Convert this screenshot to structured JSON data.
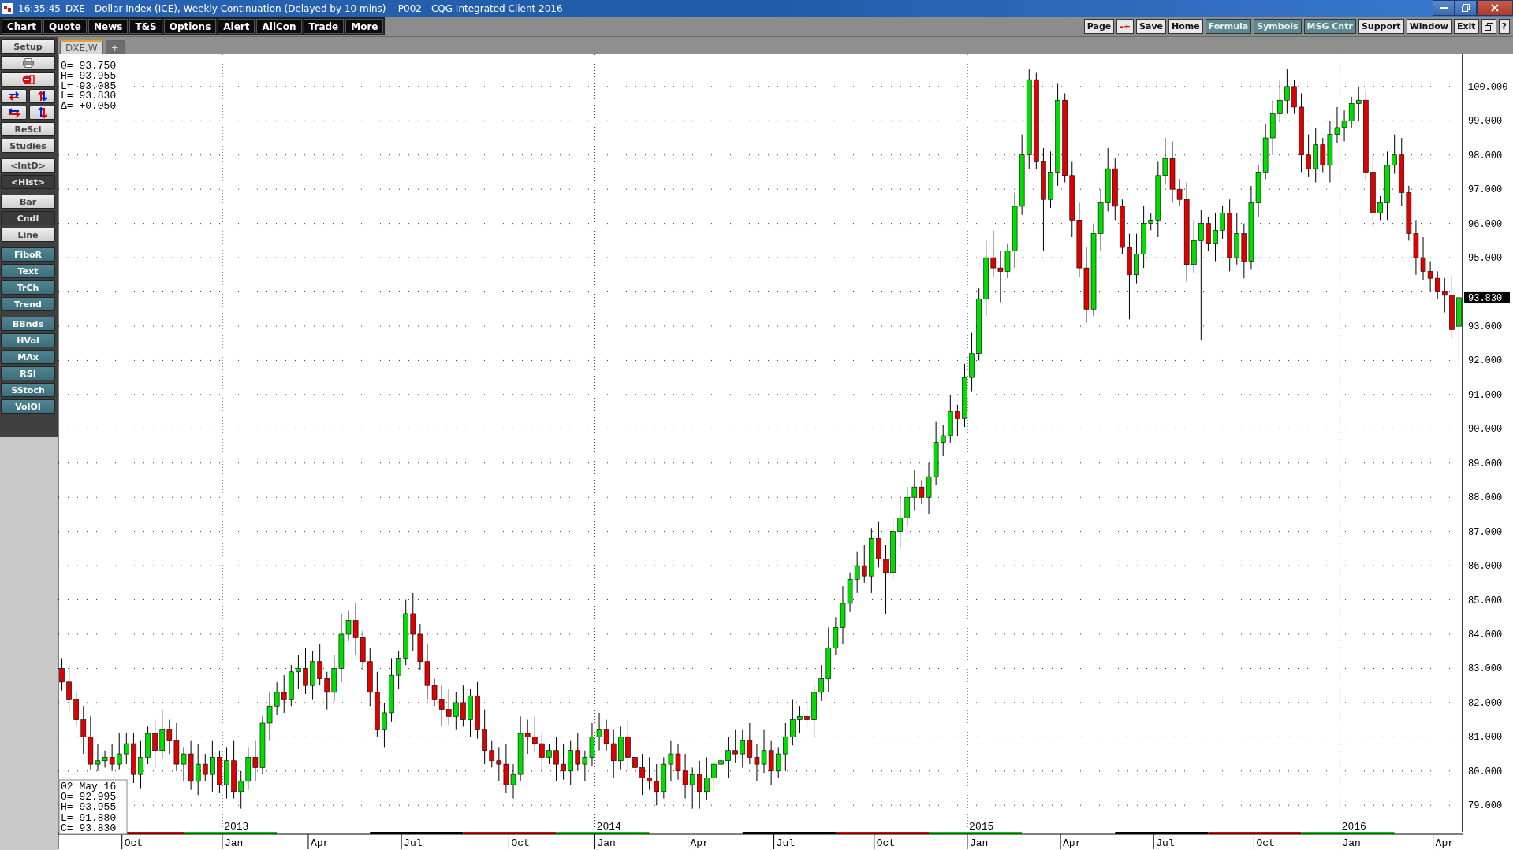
{
  "window": {
    "time": "16:35:45",
    "title": "DXE - Dollar Index (ICE), Weekly Continuation (Delayed by 10 mins)    P002 - CQG Integrated Client 2016"
  },
  "toolbar": {
    "left": [
      {
        "label": "Chart"
      },
      {
        "label": "Quote"
      },
      {
        "label": "News"
      },
      {
        "label": "T&S"
      },
      {
        "label": "Options"
      },
      {
        "label": "Alert"
      },
      {
        "label": "AllCon"
      },
      {
        "label": "Trade"
      },
      {
        "label": "More"
      }
    ],
    "right": [
      {
        "label": "Page",
        "kind": "light"
      },
      {
        "label": "-+",
        "kind": "light"
      },
      {
        "label": "Save",
        "kind": "light"
      },
      {
        "label": "Home",
        "kind": "light"
      },
      {
        "label": "Formula",
        "kind": "teal"
      },
      {
        "label": "Symbols",
        "kind": "teal"
      },
      {
        "label": "MSG Cntr",
        "kind": "teal"
      },
      {
        "label": "Support",
        "kind": "light"
      },
      {
        "label": "Window",
        "kind": "light"
      },
      {
        "label": "Exit",
        "kind": "light"
      },
      {
        "kind": "icon"
      },
      {
        "label": "?",
        "kind": "light"
      }
    ]
  },
  "sidebar": {
    "groups": [
      [
        {
          "kind": "light",
          "label": "Setup",
          "selected": false
        },
        {
          "kind": "wide_icon"
        },
        {
          "kind": "wide_icon"
        },
        {
          "kind": "half_icon"
        },
        {
          "kind": "half_icon"
        },
        {
          "kind": "half_icon"
        },
        {
          "kind": "half_icon"
        },
        {
          "kind": "light",
          "label": "ReScl",
          "selected": false
        },
        {
          "kind": "light",
          "label": "Studies",
          "selected": false
        }
      ],
      [
        {
          "kind": "light",
          "label": "<IntD>",
          "selected": false
        },
        {
          "kind": "light",
          "label": "<Hist>",
          "selected": true
        }
      ],
      [
        {
          "kind": "light",
          "label": "Bar",
          "selected": false
        },
        {
          "kind": "light",
          "label": "Cndl",
          "selected": true
        },
        {
          "kind": "light",
          "label": "Line",
          "selected": false
        }
      ],
      [
        {
          "kind": "teal",
          "label": "FiboR",
          "selected": false
        },
        {
          "kind": "teal",
          "label": "Text",
          "selected": false
        },
        {
          "kind": "teal",
          "label": "TrCh",
          "selected": false
        },
        {
          "kind": "teal",
          "label": "Trend",
          "selected": false
        }
      ],
      [
        {
          "kind": "teal",
          "label": "BBnds",
          "selected": false
        },
        {
          "kind": "teal",
          "label": "HVol",
          "selected": false
        },
        {
          "kind": "teal",
          "label": "MAx",
          "selected": false
        },
        {
          "kind": "teal",
          "label": "RSI",
          "selected": false
        },
        {
          "kind": "teal",
          "label": "SStoch",
          "selected": false
        },
        {
          "kind": "teal",
          "label": "VolOI",
          "selected": false
        }
      ]
    ]
  },
  "tabs": [
    {
      "label": "DXE,W",
      "selected": true
    },
    {
      "label": "+",
      "selected": false
    }
  ],
  "chart": {
    "readout": [
      "0= 93.750",
      "H= 93.955",
      "L= 93.085",
      "L= 93.830",
      "Δ= +0.050"
    ],
    "bar_info": [
      "02 May 16",
      "O=  92.995",
      "H=  93.955",
      "L=  91.880",
      "C=  93.830"
    ],
    "last_price": "93.830",
    "year_labels": [
      "2013",
      "2014",
      "2015",
      "2016"
    ],
    "chart_data": {
      "type": "candlestick",
      "grid": true,
      "ylim": [
        78.2,
        100.9
      ],
      "categories": [
        null,
        null,
        null,
        null,
        null,
        null,
        null,
        null,
        null,
        null,
        "Oct",
        null,
        null,
        null,
        null,
        null,
        null,
        null,
        null,
        null,
        null,
        null,
        null,
        null,
        "Jan",
        null,
        null,
        null,
        null,
        null,
        null,
        null,
        null,
        null,
        null,
        null,
        "Apr",
        null,
        null,
        null,
        null,
        null,
        null,
        null,
        null,
        null,
        null,
        null,
        null,
        "Jul",
        null,
        null,
        null,
        null,
        null,
        null,
        null,
        null,
        null,
        null,
        null,
        null,
        null,
        null,
        "Oct",
        null,
        null,
        null,
        null,
        null,
        null,
        null,
        null,
        null,
        null,
        null,
        "Jan",
        null,
        null,
        null,
        null,
        null,
        null,
        null,
        null,
        null,
        null,
        null,
        null,
        "Apr",
        null,
        null,
        null,
        null,
        null,
        null,
        null,
        null,
        null,
        null,
        null,
        "Jul",
        null,
        null,
        null,
        null,
        null,
        null,
        null,
        null,
        null,
        null,
        null,
        null,
        null,
        "Oct",
        null,
        null,
        null,
        null,
        null,
        null,
        null,
        null,
        null,
        null,
        null,
        null,
        "Jan",
        null,
        null,
        null,
        null,
        null,
        null,
        null,
        null,
        null,
        null,
        null,
        null,
        "Apr",
        null,
        null,
        null,
        null,
        null,
        null,
        null,
        null,
        null,
        null,
        null,
        null,
        "Jul",
        null,
        null,
        null,
        null,
        null,
        null,
        null,
        null,
        null,
        null,
        null,
        null,
        null,
        "Oct",
        null,
        null,
        null,
        null,
        null,
        null,
        null,
        null,
        null,
        null,
        null,
        "Jan",
        null,
        null,
        null,
        null,
        null,
        null,
        null,
        null,
        null,
        null,
        null,
        null,
        "Apr",
        null,
        null
      ],
      "yticks": [
        {
          "value": 79,
          "label": "79.000"
        },
        {
          "value": 80,
          "label": "80.000"
        },
        {
          "value": 81,
          "label": "81.000"
        },
        {
          "value": 82,
          "label": "82.000"
        },
        {
          "value": 83,
          "label": "83.000"
        },
        {
          "value": 84,
          "label": "84.000"
        },
        {
          "value": 85,
          "label": "85.000"
        },
        {
          "value": 86,
          "label": "86.000"
        },
        {
          "value": 87,
          "label": "87.000"
        },
        {
          "value": 88,
          "label": "88.000"
        },
        {
          "value": 89,
          "label": "89.000"
        },
        {
          "value": 90,
          "label": "90.000"
        },
        {
          "value": 91,
          "label": "91.000"
        },
        {
          "value": 92,
          "label": "92.000"
        },
        {
          "value": 93,
          "label": "93.000"
        },
        {
          "value": 95,
          "label": "95.000"
        },
        {
          "value": 96,
          "label": "96.000"
        },
        {
          "value": 97,
          "label": "97.000"
        },
        {
          "value": 98,
          "label": "98.000"
        },
        {
          "value": 99,
          "label": "99.000"
        },
        {
          "value": 100,
          "label": "100.000"
        }
      ],
      "ohlc": [
        [
          83.0,
          83.3,
          82.35,
          82.6
        ],
        [
          82.6,
          83.1,
          81.7,
          82.1
        ],
        [
          82.1,
          82.3,
          81.3,
          81.5
        ],
        [
          81.5,
          81.9,
          80.5,
          81.0
        ],
        [
          81.0,
          81.6,
          80.05,
          80.2
        ],
        [
          80.2,
          80.8,
          80.0,
          80.3
        ],
        [
          80.3,
          80.6,
          80.1,
          80.4
        ],
        [
          80.4,
          80.8,
          80.0,
          80.2
        ],
        [
          80.2,
          81.1,
          80.05,
          80.5
        ],
        [
          80.5,
          81.1,
          80.2,
          80.8
        ],
        [
          80.8,
          81.1,
          79.65,
          79.9
        ],
        [
          79.9,
          80.9,
          79.5,
          80.4
        ],
        [
          80.4,
          81.3,
          80.2,
          81.1
        ],
        [
          81.1,
          81.5,
          80.1,
          80.6
        ],
        [
          80.6,
          81.8,
          80.35,
          81.2
        ],
        [
          81.2,
          81.5,
          80.5,
          80.9
        ],
        [
          80.9,
          81.4,
          80.0,
          80.2
        ],
        [
          80.2,
          80.7,
          79.7,
          80.5
        ],
        [
          80.5,
          80.9,
          79.45,
          79.7
        ],
        [
          79.7,
          80.8,
          79.3,
          80.2
        ],
        [
          80.2,
          80.5,
          79.7,
          79.9
        ],
        [
          79.9,
          80.9,
          79.4,
          80.4
        ],
        [
          80.4,
          80.6,
          79.35,
          79.6
        ],
        [
          79.6,
          80.7,
          79.2,
          80.3
        ],
        [
          80.3,
          80.9,
          79.2,
          79.4
        ],
        [
          79.4,
          80.0,
          78.9,
          79.7
        ],
        [
          79.7,
          80.7,
          79.45,
          80.4
        ],
        [
          80.4,
          80.9,
          79.7,
          80.1
        ],
        [
          80.1,
          81.6,
          79.9,
          81.4
        ],
        [
          81.4,
          82.3,
          80.9,
          81.9
        ],
        [
          81.9,
          82.6,
          81.65,
          82.3
        ],
        [
          82.3,
          82.8,
          81.7,
          82.1
        ],
        [
          82.1,
          83.1,
          81.9,
          82.9
        ],
        [
          82.9,
          83.4,
          82.4,
          83.0
        ],
        [
          83.0,
          83.6,
          82.25,
          82.5
        ],
        [
          82.5,
          83.5,
          82.1,
          83.2
        ],
        [
          83.2,
          83.7,
          82.5,
          82.7
        ],
        [
          82.7,
          82.9,
          81.8,
          82.3
        ],
        [
          82.3,
          83.4,
          82.05,
          83.0
        ],
        [
          83.0,
          84.6,
          82.6,
          84.0
        ],
        [
          84.0,
          84.7,
          83.8,
          84.4
        ],
        [
          84.4,
          84.9,
          83.4,
          83.9
        ],
        [
          83.9,
          84.1,
          82.95,
          83.2
        ],
        [
          83.2,
          83.6,
          81.9,
          82.3
        ],
        [
          82.3,
          82.9,
          81.0,
          81.2
        ],
        [
          81.2,
          82.0,
          80.7,
          81.7
        ],
        [
          81.7,
          83.3,
          81.45,
          82.8
        ],
        [
          82.8,
          83.5,
          82.4,
          83.3
        ],
        [
          83.3,
          85.0,
          83.1,
          84.6
        ],
        [
          84.6,
          85.2,
          83.5,
          84.0
        ],
        [
          84.0,
          84.3,
          82.95,
          83.2
        ],
        [
          83.2,
          83.7,
          82.1,
          82.5
        ],
        [
          82.5,
          82.7,
          81.9,
          82.1
        ],
        [
          82.1,
          82.5,
          81.3,
          81.8
        ],
        [
          81.8,
          82.4,
          81.35,
          81.6
        ],
        [
          81.6,
          82.3,
          81.2,
          82.0
        ],
        [
          82.0,
          82.5,
          81.3,
          81.5
        ],
        [
          81.5,
          82.4,
          81.0,
          82.2
        ],
        [
          82.2,
          82.6,
          80.95,
          81.2
        ],
        [
          81.2,
          81.8,
          80.2,
          80.6
        ],
        [
          80.6,
          80.9,
          80.1,
          80.3
        ],
        [
          80.3,
          80.7,
          79.7,
          80.2
        ],
        [
          80.2,
          80.8,
          79.35,
          79.6
        ],
        [
          79.6,
          80.2,
          79.2,
          79.9
        ],
        [
          79.9,
          81.6,
          79.7,
          81.1
        ],
        [
          81.1,
          81.5,
          80.5,
          81.0
        ],
        [
          81.0,
          81.6,
          80.55,
          80.8
        ],
        [
          80.8,
          81.1,
          80.0,
          80.4
        ],
        [
          80.4,
          80.8,
          80.2,
          80.6
        ],
        [
          80.6,
          81.0,
          79.7,
          80.2
        ],
        [
          80.2,
          80.8,
          79.75,
          80.0
        ],
        [
          80.0,
          80.9,
          79.6,
          80.6
        ],
        [
          80.6,
          81.1,
          80.0,
          80.2
        ],
        [
          80.2,
          80.6,
          79.7,
          80.4
        ],
        [
          80.4,
          81.4,
          80.15,
          81.0
        ],
        [
          81.0,
          81.7,
          80.6,
          81.2
        ],
        [
          81.2,
          81.5,
          80.6,
          80.8
        ],
        [
          80.8,
          81.2,
          79.8,
          80.3
        ],
        [
          80.3,
          81.3,
          80.05,
          81.0
        ],
        [
          81.0,
          81.5,
          80.0,
          80.4
        ],
        [
          80.4,
          80.6,
          79.9,
          80.1
        ],
        [
          80.1,
          80.5,
          79.3,
          79.8
        ],
        [
          79.8,
          80.4,
          79.45,
          79.7
        ],
        [
          79.7,
          80.2,
          79.0,
          79.4
        ],
        [
          79.4,
          80.4,
          79.2,
          80.2
        ],
        [
          80.2,
          80.9,
          79.7,
          80.5
        ],
        [
          80.5,
          80.8,
          79.75,
          80.0
        ],
        [
          80.0,
          80.5,
          79.2,
          79.6
        ],
        [
          79.6,
          80.1,
          78.9,
          79.9
        ],
        [
          79.9,
          80.3,
          78.9,
          79.4
        ],
        [
          79.4,
          80.4,
          79.15,
          79.8
        ],
        [
          79.8,
          80.4,
          79.4,
          80.2
        ],
        [
          80.2,
          80.5,
          80.0,
          80.3
        ],
        [
          80.3,
          81.0,
          79.8,
          80.6
        ],
        [
          80.6,
          81.2,
          80.25,
          80.5
        ],
        [
          80.5,
          81.2,
          80.1,
          80.9
        ],
        [
          80.9,
          81.4,
          80.2,
          80.4
        ],
        [
          80.4,
          80.8,
          79.7,
          80.2
        ],
        [
          80.2,
          81.2,
          79.95,
          80.6
        ],
        [
          80.6,
          80.9,
          79.6,
          80.0
        ],
        [
          80.0,
          80.7,
          79.8,
          80.5
        ],
        [
          80.5,
          81.4,
          80.0,
          81.0
        ],
        [
          81.0,
          82.1,
          80.75,
          81.5
        ],
        [
          81.5,
          81.9,
          81.1,
          81.6
        ],
        [
          81.6,
          82.1,
          81.3,
          81.5
        ],
        [
          81.5,
          82.5,
          81.0,
          82.3
        ],
        [
          82.3,
          83.1,
          82.05,
          82.7
        ],
        [
          82.7,
          84.2,
          82.3,
          83.6
        ],
        [
          83.6,
          84.5,
          83.4,
          84.2
        ],
        [
          84.2,
          85.4,
          83.7,
          84.9
        ],
        [
          84.9,
          85.8,
          84.65,
          85.6
        ],
        [
          85.6,
          86.4,
          85.2,
          86.0
        ],
        [
          86.0,
          86.6,
          85.5,
          85.7
        ],
        [
          85.7,
          87.1,
          85.2,
          86.8
        ],
        [
          86.8,
          87.3,
          85.95,
          86.2
        ],
        [
          86.2,
          86.6,
          84.6,
          85.8
        ],
        [
          85.8,
          87.4,
          85.6,
          87.0
        ],
        [
          87.0,
          88.0,
          86.5,
          87.4
        ],
        [
          87.4,
          88.3,
          87.15,
          88.0
        ],
        [
          88.0,
          88.8,
          87.6,
          88.3
        ],
        [
          88.3,
          88.5,
          87.8,
          88.0
        ],
        [
          88.0,
          89.0,
          87.5,
          88.6
        ],
        [
          88.6,
          90.2,
          88.35,
          89.6
        ],
        [
          89.6,
          90.1,
          89.2,
          89.8
        ],
        [
          89.8,
          91.0,
          89.6,
          90.5
        ],
        [
          90.5,
          90.7,
          89.8,
          90.3
        ],
        [
          90.3,
          91.9,
          90.05,
          91.5
        ],
        [
          91.5,
          92.8,
          91.1,
          92.2
        ],
        [
          92.2,
          94.1,
          92.0,
          93.8
        ],
        [
          93.8,
          95.5,
          93.3,
          95.0
        ],
        [
          95.0,
          95.8,
          94.45,
          94.7
        ],
        [
          94.7,
          95.2,
          93.7,
          94.6
        ],
        [
          94.6,
          95.4,
          94.4,
          95.2
        ],
        [
          95.2,
          96.9,
          94.7,
          96.5
        ],
        [
          96.5,
          98.6,
          96.25,
          98.0
        ],
        [
          98.0,
          100.5,
          97.6,
          100.2
        ],
        [
          100.2,
          100.4,
          97.6,
          97.8
        ],
        [
          97.8,
          98.2,
          95.2,
          96.7
        ],
        [
          96.7,
          98.1,
          96.45,
          97.5
        ],
        [
          97.5,
          100.1,
          97.1,
          99.6
        ],
        [
          99.6,
          99.8,
          97.2,
          97.4
        ],
        [
          97.4,
          97.8,
          95.6,
          96.1
        ],
        [
          96.1,
          96.6,
          94.45,
          94.7
        ],
        [
          94.7,
          95.3,
          93.1,
          93.5
        ],
        [
          93.5,
          96.0,
          93.3,
          95.7
        ],
        [
          95.7,
          97.0,
          95.2,
          96.6
        ],
        [
          96.6,
          98.2,
          96.35,
          97.6
        ],
        [
          97.6,
          97.9,
          96.1,
          96.5
        ],
        [
          96.5,
          96.7,
          95.1,
          95.3
        ],
        [
          95.3,
          95.7,
          93.2,
          94.5
        ],
        [
          94.5,
          95.7,
          94.25,
          95.1
        ],
        [
          95.1,
          96.5,
          94.7,
          96.0
        ],
        [
          96.0,
          96.3,
          95.8,
          96.1
        ],
        [
          96.1,
          97.8,
          95.6,
          97.4
        ],
        [
          97.4,
          98.5,
          97.15,
          97.9
        ],
        [
          97.9,
          98.4,
          96.6,
          97.0
        ],
        [
          97.0,
          97.3,
          96.5,
          96.7
        ],
        [
          96.7,
          97.2,
          94.3,
          94.8
        ],
        [
          94.8,
          96.1,
          94.55,
          95.5
        ],
        [
          95.5,
          96.4,
          92.6,
          96.0
        ],
        [
          96.0,
          96.2,
          95.2,
          95.4
        ],
        [
          95.4,
          96.3,
          94.9,
          95.8
        ],
        [
          95.8,
          96.5,
          95.55,
          96.3
        ],
        [
          96.3,
          96.7,
          94.6,
          95.0
        ],
        [
          95.0,
          96.3,
          94.8,
          95.7
        ],
        [
          95.7,
          96.0,
          94.4,
          94.9
        ],
        [
          94.9,
          97.1,
          94.65,
          96.6
        ],
        [
          96.6,
          97.7,
          96.2,
          97.5
        ],
        [
          97.5,
          98.9,
          97.3,
          98.5
        ],
        [
          98.5,
          99.6,
          98.0,
          99.2
        ],
        [
          99.2,
          100.2,
          98.95,
          99.6
        ],
        [
          99.6,
          100.5,
          99.2,
          100.0
        ],
        [
          100.0,
          100.2,
          99.2,
          99.4
        ],
        [
          99.4,
          99.8,
          97.5,
          98.0
        ],
        [
          98.0,
          98.6,
          97.35,
          97.6
        ],
        [
          97.6,
          98.8,
          97.2,
          98.3
        ],
        [
          98.3,
          98.5,
          97.5,
          97.7
        ],
        [
          97.7,
          99.0,
          97.2,
          98.6
        ],
        [
          98.6,
          99.4,
          98.35,
          98.8
        ],
        [
          98.8,
          99.3,
          98.4,
          99.0
        ],
        [
          99.0,
          99.7,
          98.8,
          99.5
        ],
        [
          99.5,
          100.0,
          99.0,
          99.6
        ],
        [
          99.6,
          99.9,
          97.25,
          97.5
        ],
        [
          97.5,
          98.0,
          95.9,
          96.3
        ],
        [
          96.3,
          96.8,
          96.1,
          96.6
        ],
        [
          96.6,
          98.1,
          96.1,
          97.7
        ],
        [
          97.7,
          98.6,
          97.45,
          98.0
        ],
        [
          98.0,
          98.5,
          96.5,
          96.9
        ],
        [
          96.9,
          97.1,
          95.5,
          95.7
        ],
        [
          95.7,
          96.1,
          94.5,
          95.0
        ],
        [
          95.0,
          95.6,
          94.35,
          94.6
        ],
        [
          94.6,
          94.9,
          94.0,
          94.4
        ],
        [
          94.4,
          94.6,
          93.8,
          94.0
        ],
        [
          94.0,
          94.4,
          93.4,
          93.9
        ],
        [
          93.9,
          94.5,
          92.65,
          92.9
        ],
        [
          92.995,
          93.955,
          91.88,
          93.83
        ]
      ]
    }
  }
}
